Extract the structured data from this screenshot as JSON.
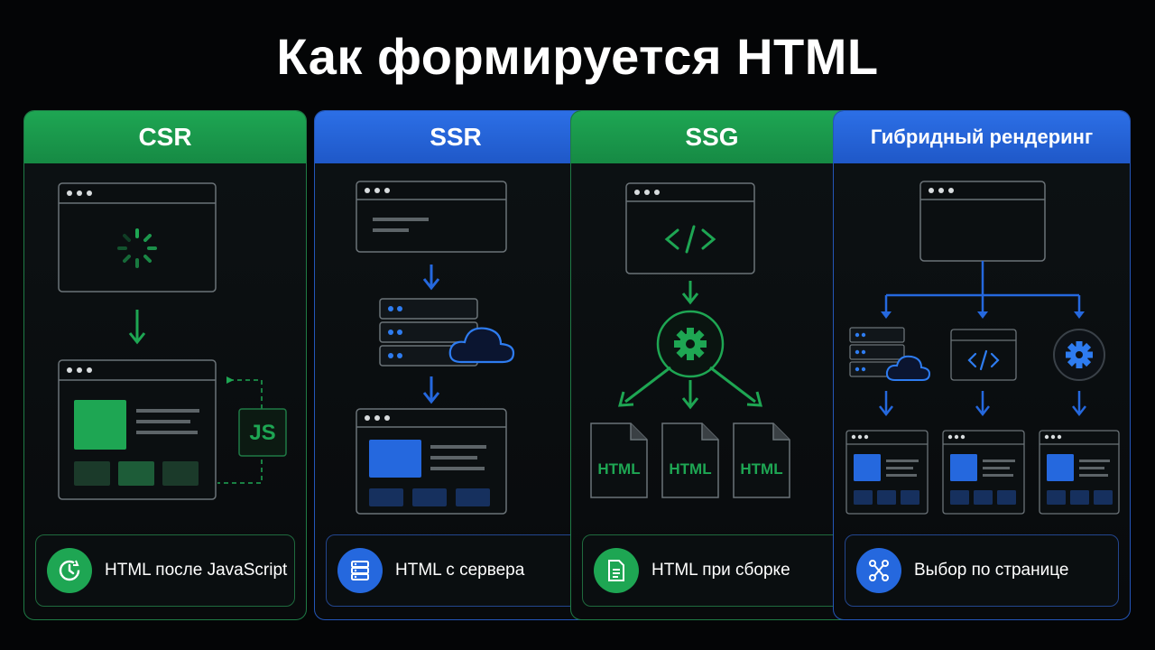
{
  "title": "Как формируется HTML",
  "panels": [
    {
      "header": "CSR",
      "caption": "HTML после JavaScript",
      "badge": "JS",
      "icon": "clock-refresh-icon"
    },
    {
      "header": "SSR",
      "caption": "HTML с сервера",
      "icon": "server-icon"
    },
    {
      "header": "SSG",
      "caption": "HTML при сборке",
      "files": [
        "HTML",
        "HTML",
        "HTML"
      ],
      "icon": "document-icon"
    },
    {
      "header": "Гибридный рендеринг",
      "caption": "Выбор по странице",
      "icon": "branch-icon"
    }
  ],
  "colors": {
    "green": "#1ea653",
    "blue": "#2568de",
    "background": "#040506"
  }
}
